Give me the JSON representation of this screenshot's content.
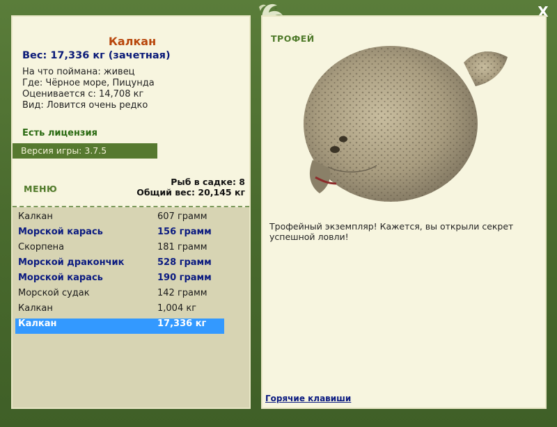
{
  "window": {
    "close_label": "X"
  },
  "fish": {
    "name": "Калкан",
    "weight_line": "Вес: 17,336 кг (зачетная)",
    "caught_on": "На что поймана: живец",
    "location": "Где: Чёрное море, Пицунда",
    "valued_from": "Оценивается с: 14,708 кг",
    "rarity": "Вид: Ловится очень редко"
  },
  "license": "Есть лицензия",
  "version": "Версия игры: 3.7.5",
  "menu_label": "МЕНЮ",
  "stats": {
    "fish_in_keepnet": "Рыб в садке: 8",
    "total_weight": "Общий вес: 20,145 кг"
  },
  "catch_list": [
    {
      "name": "Калкан",
      "weight": "607 грамм",
      "style": "normal"
    },
    {
      "name": "Морской карась",
      "weight": "156 грамм",
      "style": "bold"
    },
    {
      "name": "Скорпена",
      "weight": "181 грамм",
      "style": "normal"
    },
    {
      "name": "Морской дракончик",
      "weight": "528 грамм",
      "style": "bold"
    },
    {
      "name": "Морской карась",
      "weight": "190 грамм",
      "style": "bold"
    },
    {
      "name": "Морской судак",
      "weight": "142 грамм",
      "style": "normal"
    },
    {
      "name": "Калкан",
      "weight": "1,004 кг",
      "style": "normal"
    },
    {
      "name": "Калкан",
      "weight": "17,336 кг",
      "style": "selected"
    }
  ],
  "trophy": {
    "label": "ТРОФЕЙ",
    "text": "Трофейный экземпляр! Кажется, вы открыли секрет успешной ловли!"
  },
  "hotkeys_label": "Горячие клавиши",
  "colors": {
    "frame_green": "#4f7232",
    "panel_cream": "#f7f5df",
    "title_orange": "#b8460b",
    "weight_blue": "#0a1a78",
    "selection_blue": "#3399ff"
  }
}
